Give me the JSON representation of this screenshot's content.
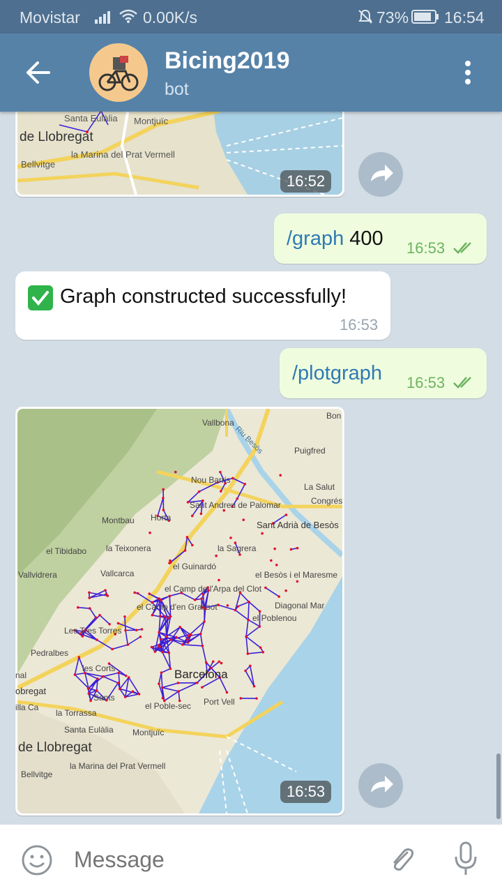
{
  "status": {
    "carrier": "Movistar",
    "speed": "0.00K/s",
    "battery": "73%",
    "time": "16:54"
  },
  "header": {
    "title": "Bicing2019",
    "subtitle": "bot"
  },
  "messages": [
    {
      "kind": "photo",
      "from": "bot",
      "time": "16:52"
    },
    {
      "kind": "text",
      "from": "me",
      "command": "/graph",
      "arg": " 400",
      "time": "16:53"
    },
    {
      "kind": "text",
      "from": "bot",
      "emoji": "✅",
      "text": "Graph constructed successfully!",
      "time": "16:53"
    },
    {
      "kind": "text",
      "from": "me",
      "command": "/plotgraph",
      "time": "16:53"
    },
    {
      "kind": "photo",
      "from": "bot",
      "time": "16:53"
    }
  ],
  "map_labels": {
    "top_photo": [
      "Santa Eulàlia",
      "Montjuïc",
      "de Llobregat",
      "la Marina del Prat Vermell",
      "Bellvitge"
    ],
    "bottom_photo": [
      "Vallbona",
      "Riu Besòs",
      "Puigfred",
      "Bon",
      "Nou Barris",
      "La Salut",
      "Sant Andreu de Palomar",
      "Congrés",
      "Montbau",
      "Horta",
      "Sant Adrià de Besòs",
      "el Tibidabo",
      "la Teixonera",
      "la Sagrera",
      "Vallvidrera",
      "Vallcarca",
      "el Guinardó",
      "el Besòs i el Maresme",
      "el Camp de l'Arpa del Clot",
      "el Camp d'en Grassot",
      "Diagonal Mar",
      "el Poblenou",
      "Les Tres Torres",
      "Pedralbes",
      "les Corts",
      "Barcelona",
      "obregat",
      "Sants",
      "el Poble-sec",
      "Port Vell",
      "la Torrassa",
      "Santa Eulàlia",
      "Montjuïc",
      "de Llobregat",
      "la Marina del Prat Vermell",
      "Bellvitge",
      "nal",
      "illa Ca"
    ]
  },
  "input": {
    "placeholder": "Message"
  },
  "colors": {
    "header": "#5682a8",
    "statusbar": "#4e6f8f",
    "outgoing": "#effdde",
    "incoming": "#ffffff",
    "accent": "#2f7ab3",
    "graph_edges": "#3b1fd6",
    "graph_nodes": "#e0102a"
  }
}
